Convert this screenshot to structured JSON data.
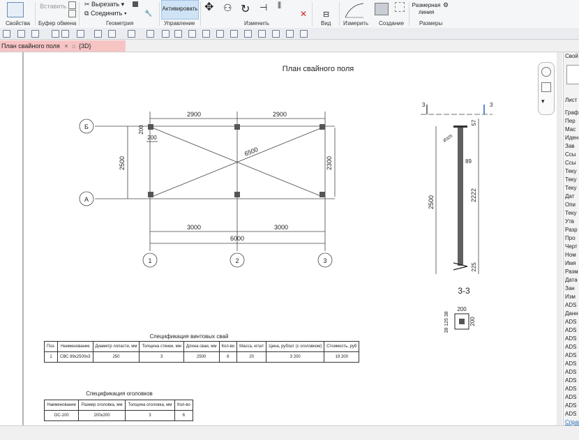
{
  "ribbon": {
    "properties": "Свойства",
    "paste": "Вставить",
    "clipboard_group": "Буфер обмена",
    "cut": "Вырезать",
    "join": "Соединить",
    "geometry_group": "Геометрия",
    "activate": "Активировать",
    "manage_group": "Управление",
    "modify_group": "Изменить",
    "view_group": "Вид",
    "measure_group": "Измерить",
    "create_group": "Создание",
    "dimension_line": "Размерная линия",
    "dimensions_group": "Размеры"
  },
  "tabs": {
    "active": "План свайного поля",
    "close": "×",
    "second": "{3D}"
  },
  "drawing": {
    "title": "План свайного поля",
    "axis_b": "Б",
    "axis_a": "А",
    "axis_1": "1",
    "axis_2": "2",
    "axis_3": "3",
    "dim_top_1": "2900",
    "dim_top_2": "2900",
    "dim_200_top": "200",
    "dim_200_left": "200",
    "dim_left": "2500",
    "dim_right": "2300",
    "dim_diag": "6500",
    "dim_bottom_1": "3000",
    "dim_bottom_2": "3000",
    "dim_total": "6000",
    "sect_mark_left": "3",
    "sect_mark_right": "3",
    "pile_57": "57",
    "pile_89": "89",
    "pile_2222": "2222",
    "pile_225": "225",
    "pile_2500": "2500",
    "pile_label": "Ø325",
    "section_title": "3-3",
    "cap_200_top": "200",
    "cap_200_right": "200",
    "cap_left_dims": "38 125 38"
  },
  "spec_piles": {
    "title": "Спецификация винтовых свай",
    "headers": [
      "Поз.",
      "Наименование",
      "Диаметр лопасти, мм",
      "Толщина стенки, мм",
      "Длина сваи, мм",
      "Кол-во",
      "Масса, кг/шт",
      "Цена, руб/шт (с оголовком)",
      "Стоимость, руб"
    ],
    "rows": [
      [
        "1",
        "СВС 89х2500х3",
        "250",
        "3",
        "2500",
        "6",
        "20",
        "3 200",
        "19 200"
      ]
    ]
  },
  "spec_caps": {
    "title": "Спецификация оголовков",
    "headers": [
      "Наименование",
      "Размер оголовка, мм",
      "Толщина оголовка, мм",
      "Кол-во"
    ],
    "rows": [
      [
        "ОС-100",
        "200х200",
        "3",
        "6"
      ]
    ]
  },
  "right_panel": {
    "header": "Свой",
    "sheets": "Лист",
    "items": [
      "Граф",
      "Пер",
      "Мас",
      "Иден",
      "Зав",
      "Ссы",
      "Ссы",
      "Теку",
      "Теку",
      "Теку",
      "Дат",
      "Опи",
      "Теку",
      "Утв",
      "Разр",
      "Про",
      "Черт",
      "Ном",
      "Имя",
      "Разм",
      "Дата",
      "Зан",
      "Изм",
      "ADS",
      "Данн",
      "ADS",
      "ADS",
      "ADS",
      "ADS",
      "ADS",
      "ADS",
      "ADS",
      "ADS",
      "ADS",
      "ADS",
      "ADS",
      "ADS"
    ],
    "help": "Справ"
  },
  "colors": {
    "accent": "#2a6fbe",
    "tab_active_bg": "#f7c4c4",
    "activate_bg": "#cfe3f6"
  }
}
